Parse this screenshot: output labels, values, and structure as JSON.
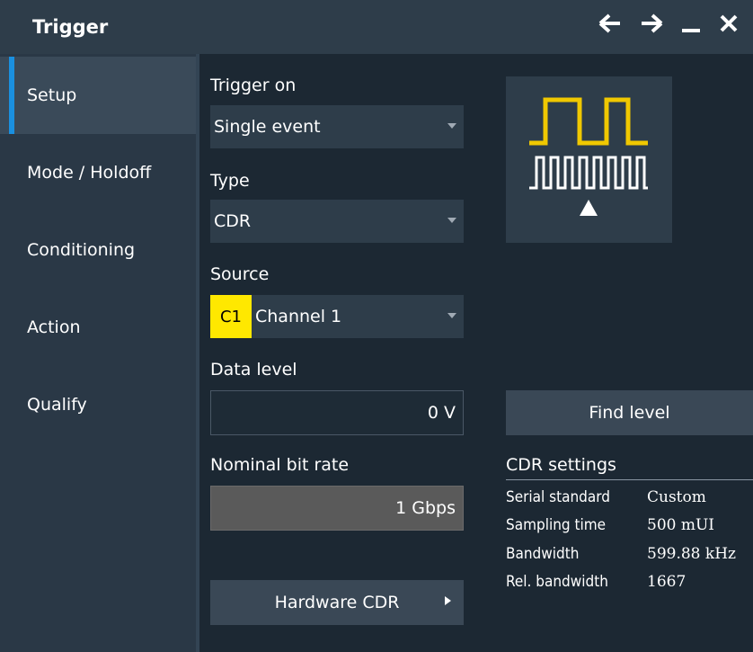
{
  "window": {
    "title": "Trigger",
    "controls": [
      "back-arrow-icon",
      "forward-arrow-icon",
      "minimize-icon",
      "close-icon"
    ]
  },
  "sidebar": {
    "items": [
      {
        "label": "Setup",
        "active": true
      },
      {
        "label": "Mode / Holdoff"
      },
      {
        "label": "Conditioning"
      },
      {
        "label": "Action"
      },
      {
        "label": "Qualify"
      }
    ]
  },
  "form": {
    "trigger_on_label": "Trigger on",
    "trigger_on_value": "Single event",
    "type_label": "Type",
    "type_value": "CDR",
    "source_label": "Source",
    "source_badge": "C1",
    "source_value": "Channel 1",
    "data_level_label": "Data level",
    "data_level_value": "0 V",
    "bit_rate_label": "Nominal bit rate",
    "bit_rate_value": "1 Gbps",
    "hw_cdr_label": "Hardware CDR",
    "find_level_label": "Find level"
  },
  "cdr_settings": {
    "title": "CDR settings",
    "rows": [
      {
        "key": "Serial standard",
        "value": "Custom"
      },
      {
        "key": "Sampling time",
        "value": "500 mUI"
      },
      {
        "key": "Bandwidth",
        "value": "599.88 kHz"
      },
      {
        "key": "Rel. bandwidth",
        "value": "1667"
      }
    ]
  },
  "colors": {
    "accent": "#1a90e0",
    "channel1": "#ffe800",
    "waveform_yellow": "#f0c800"
  }
}
